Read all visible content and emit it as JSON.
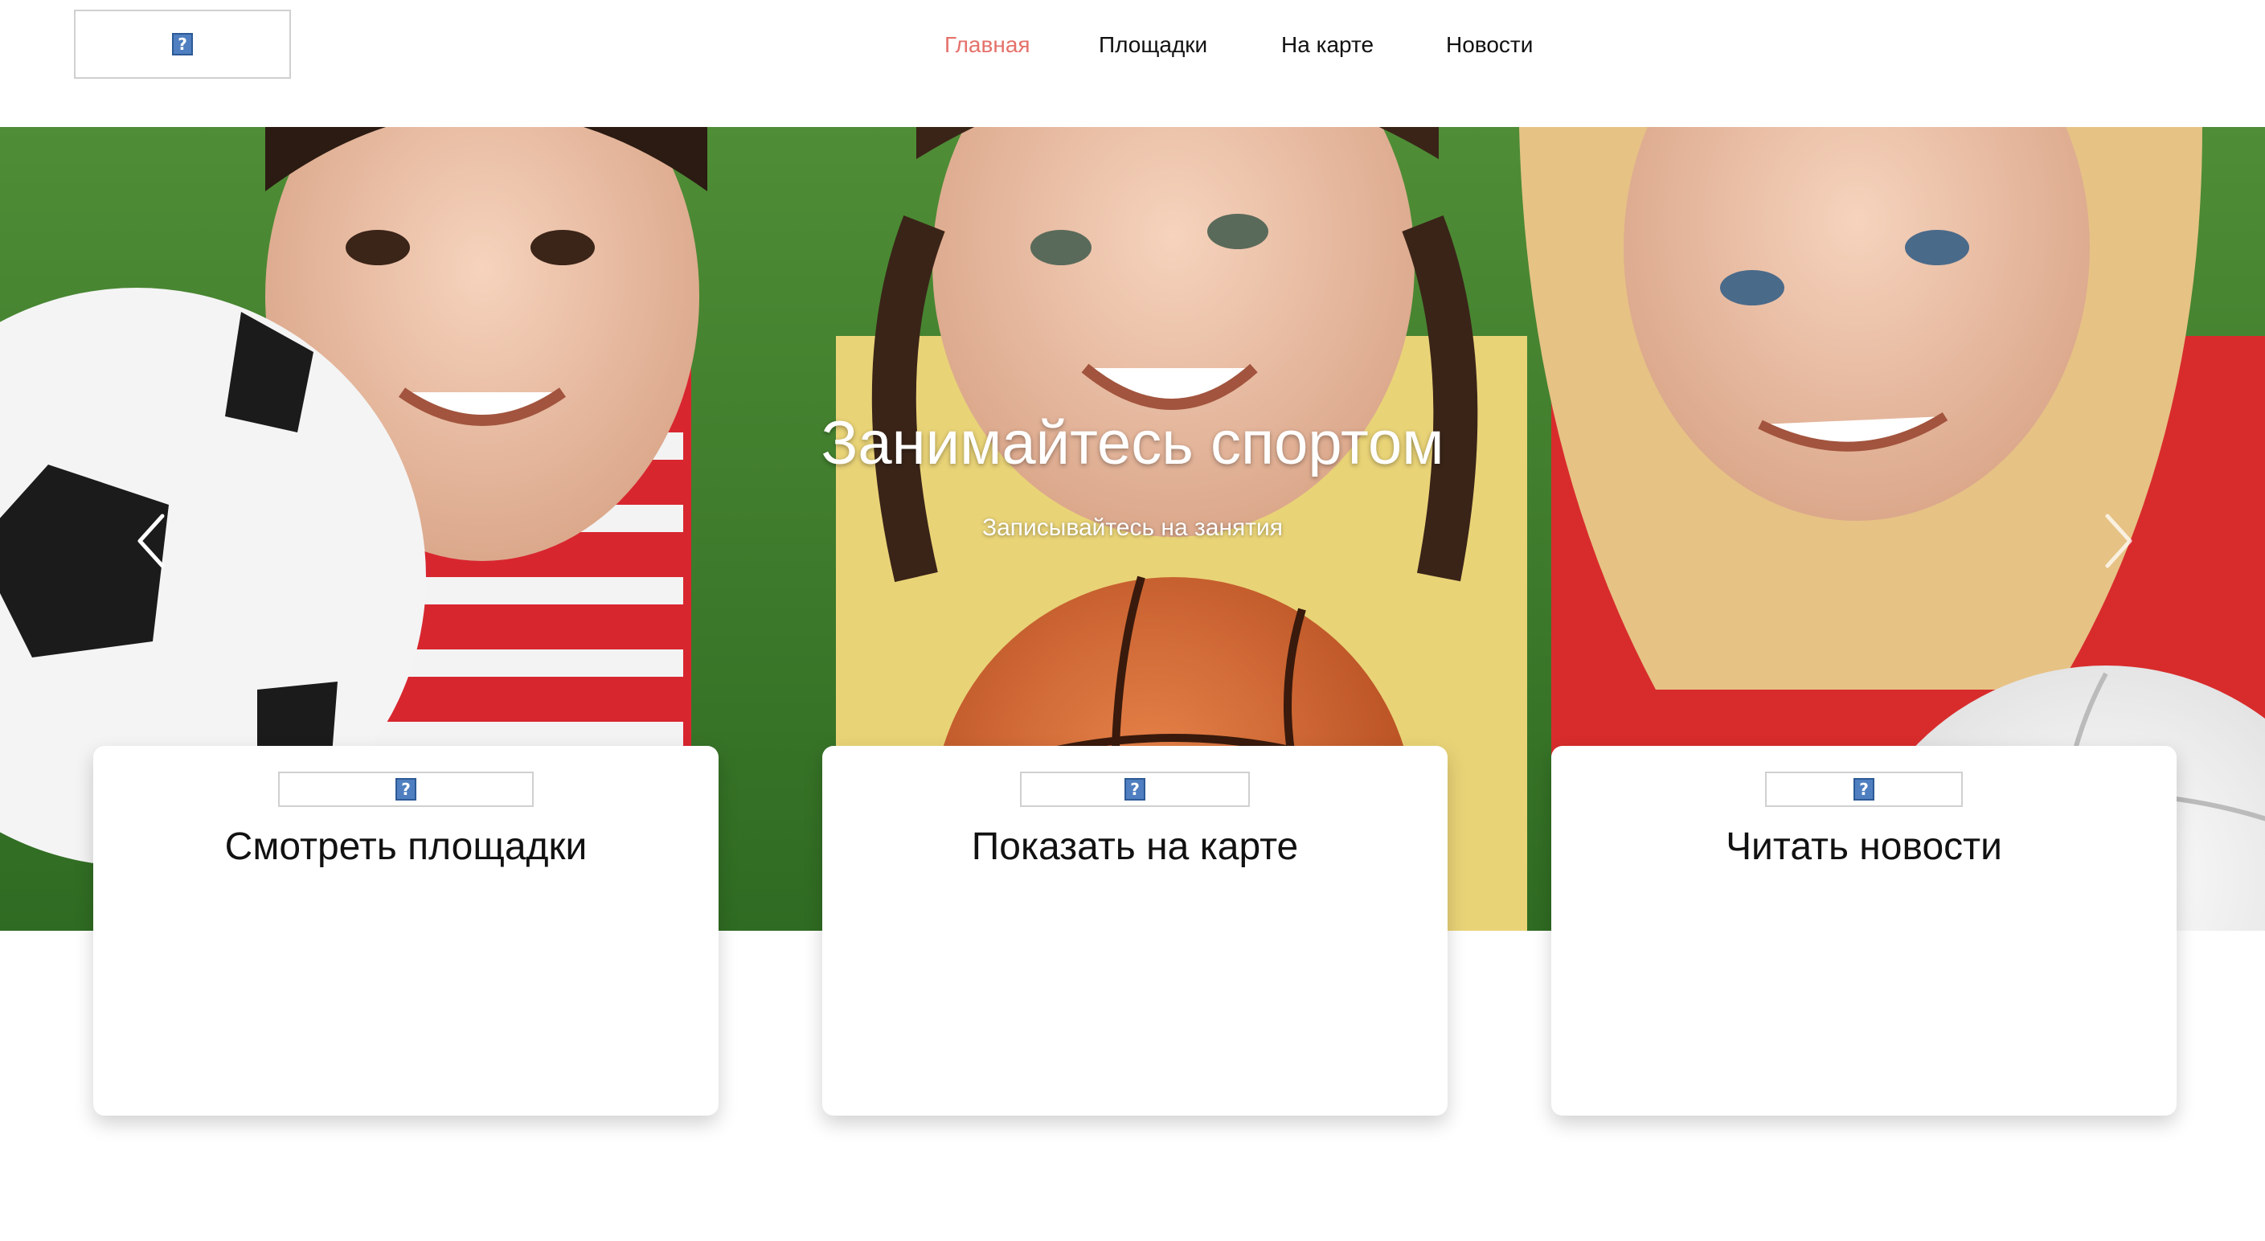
{
  "header": {
    "logo_icon": "broken-image-icon",
    "nav": [
      {
        "label": "Главная",
        "active": true
      },
      {
        "label": "Площадки",
        "active": false
      },
      {
        "label": "На карте",
        "active": false
      },
      {
        "label": "Новости",
        "active": false
      }
    ]
  },
  "hero": {
    "title": "Занимайтесь спортом",
    "subtitle": "Записывайтесь на занятия",
    "prev_icon": "chevron-left-icon",
    "next_icon": "chevron-right-icon"
  },
  "cards": [
    {
      "title": "Смотреть площадки",
      "icon": "broken-image-icon"
    },
    {
      "title": "Показать на карте",
      "icon": "broken-image-icon"
    },
    {
      "title": "Читать новости",
      "icon": "broken-image-icon"
    }
  ],
  "colors": {
    "nav_active": "#e5716b",
    "text": "#111111",
    "card_bg": "#ffffff"
  }
}
